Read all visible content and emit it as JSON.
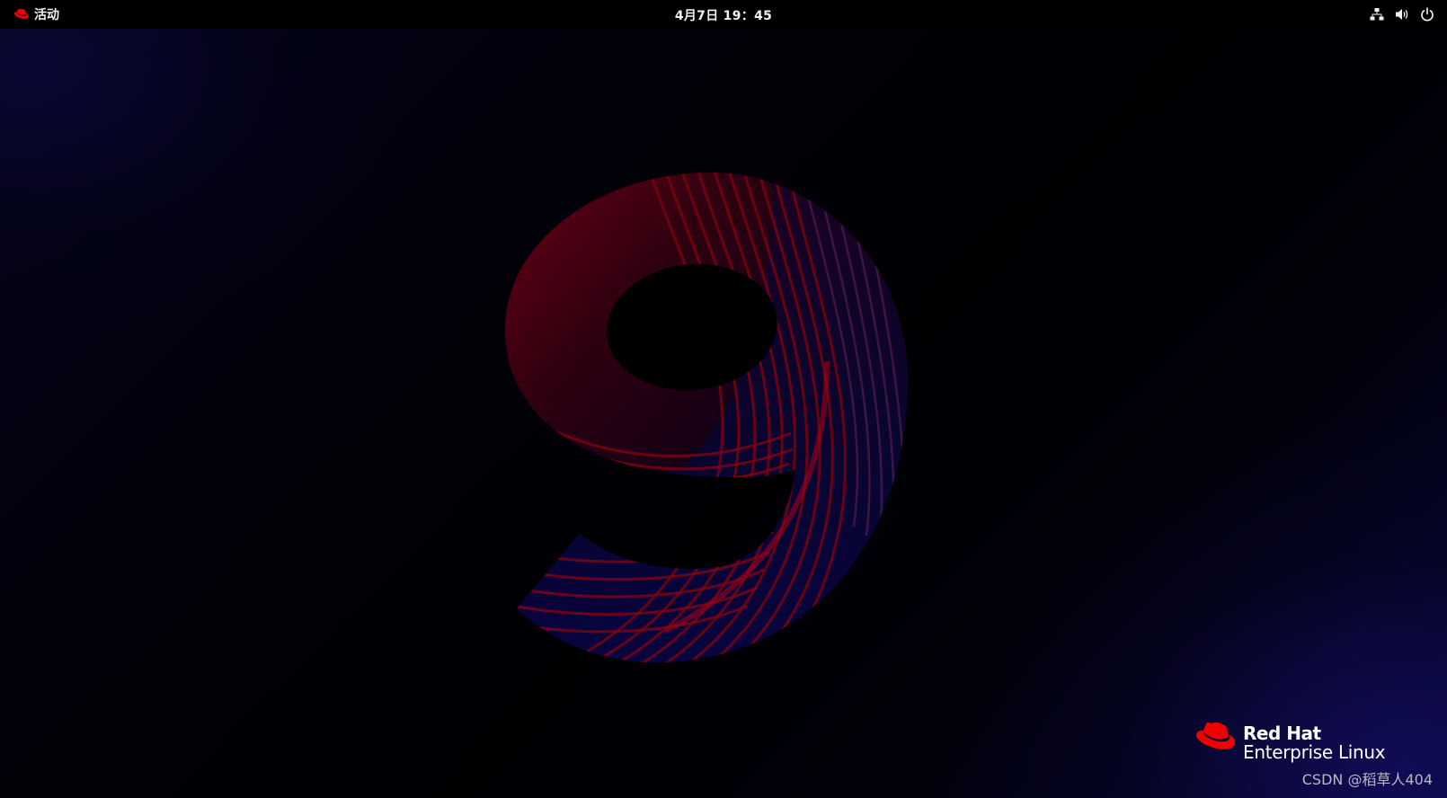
{
  "topbar": {
    "activities_label": "活动",
    "clock": "4月7日  19：45",
    "tray": [
      {
        "icon": "network-icon"
      },
      {
        "icon": "volume-icon"
      },
      {
        "icon": "power-icon"
      }
    ]
  },
  "desktop": {
    "wallpaper_glyph": "9",
    "brand": {
      "line1": "Red Hat",
      "line2": "Enterprise Linux"
    },
    "watermark": "CSDN @稻草人404"
  },
  "colors": {
    "topbar_bg": "#000000",
    "brand_red": "#ee0000",
    "wallpaper_red": "#8a0010",
    "wallpaper_blue": "#0a0840"
  }
}
